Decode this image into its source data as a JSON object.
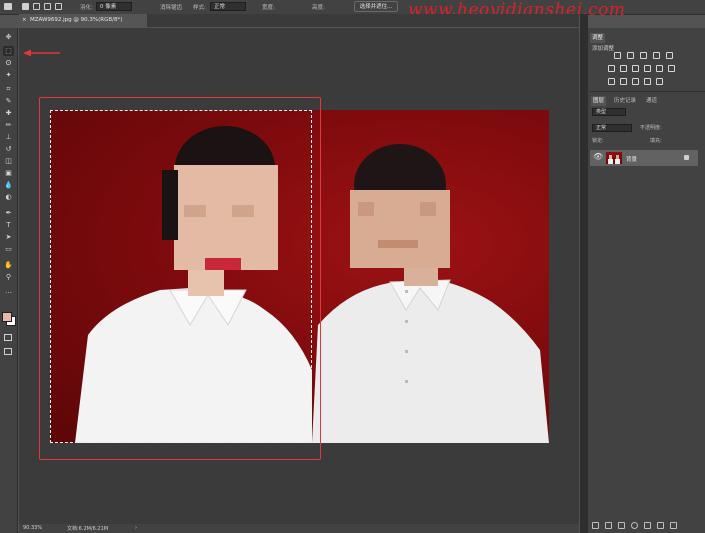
{
  "options_bar": {
    "mode_label": "羽化:",
    "mode_value": "0 像素",
    "antialias_label": "消除锯齿",
    "style_label": "样式:",
    "style_value": "正常",
    "width_label": "宽度:",
    "height_label": "高度:",
    "select_mask_button": "选择并遮住..."
  },
  "watermark": "www.heoyidianshej.com",
  "document_tab": {
    "title": "MZAW9692.jpg @ 90.3%(RGB/8*)",
    "close": "×"
  },
  "tools": [
    "move-tool-icon",
    "marquee-tool-icon",
    "lasso-tool-icon",
    "magic-wand-tool-icon",
    "crop-tool-icon",
    "eyedropper-tool-icon",
    "healing-brush-tool-icon",
    "brush-tool-icon",
    "clone-stamp-tool-icon",
    "history-brush-tool-icon",
    "eraser-tool-icon",
    "gradient-tool-icon",
    "blur-tool-icon",
    "dodge-tool-icon",
    "pen-tool-icon",
    "type-tool-icon",
    "path-selection-tool-icon",
    "rectangle-tool-icon",
    "hand-tool-icon",
    "zoom-tool-icon",
    "more-tools-icon"
  ],
  "tool_glyphs": [
    "✥",
    "⬚",
    "ʘ",
    "✦",
    "⌗",
    "✎",
    "✚",
    "✏",
    "⊥",
    "↺",
    "◫",
    "▣",
    "💧",
    "◐",
    "✒",
    "T",
    "➤",
    "▭",
    "✋",
    "⚲",
    "…"
  ],
  "status_bar": {
    "zoom": "90.33%",
    "doc_info": "文档:6.2M/6.21M"
  },
  "panels": {
    "adjustments_tab": "调整",
    "adjustments_title": "添加调整",
    "layers_tabs": [
      "图层",
      "历史记录",
      "通道"
    ],
    "layer_kind_placeholder": "类型",
    "blend_mode": "正常",
    "opacity_label": "不透明度:",
    "lock_label": "锁定:",
    "fill_label": "填充:",
    "layer_name": "背景"
  },
  "colors": {
    "accent": "#e0383d",
    "foreground_swatch": "#e8b8a8",
    "background_swatch": "#ffffff",
    "photo_background": "#8a0c0e"
  }
}
